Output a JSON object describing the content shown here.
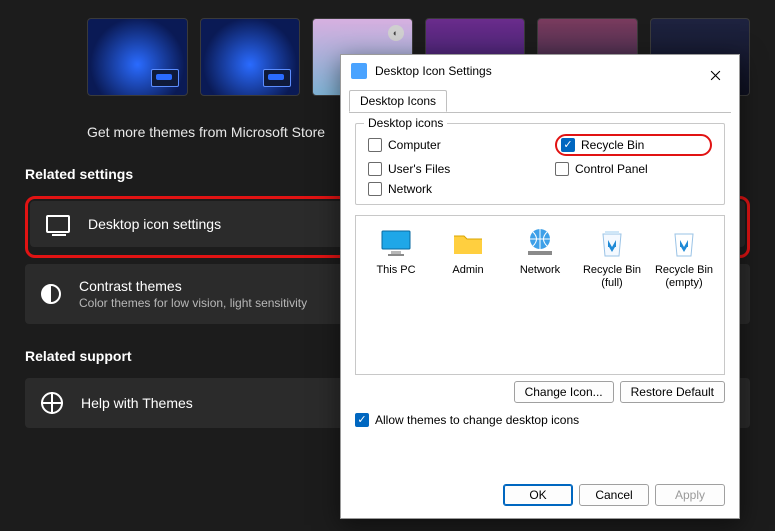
{
  "settings": {
    "store_link": "Get more themes from Microsoft Store",
    "section_related_settings": "Related settings",
    "section_related_support": "Related support",
    "cards": {
      "desktop_icon": {
        "title": "Desktop icon settings"
      },
      "contrast": {
        "title": "Contrast themes",
        "sub": "Color themes for low vision, light sensitivity"
      },
      "help": {
        "title": "Help with Themes"
      }
    }
  },
  "dialog": {
    "title": "Desktop Icon Settings",
    "tab": "Desktop Icons",
    "group_legend": "Desktop icons",
    "checks": {
      "computer": "Computer",
      "users_files": "User's Files",
      "network": "Network",
      "recycle_bin": "Recycle Bin",
      "control_panel": "Control Panel"
    },
    "icons": {
      "this_pc": "This PC",
      "admin": "Admin",
      "network": "Network",
      "rb_full": "Recycle Bin (full)",
      "rb_empty": "Recycle Bin (empty)"
    },
    "buttons": {
      "change_icon": "Change Icon...",
      "restore_default": "Restore Default",
      "ok": "OK",
      "cancel": "Cancel",
      "apply": "Apply"
    },
    "allow_themes": "Allow themes to change desktop icons"
  }
}
